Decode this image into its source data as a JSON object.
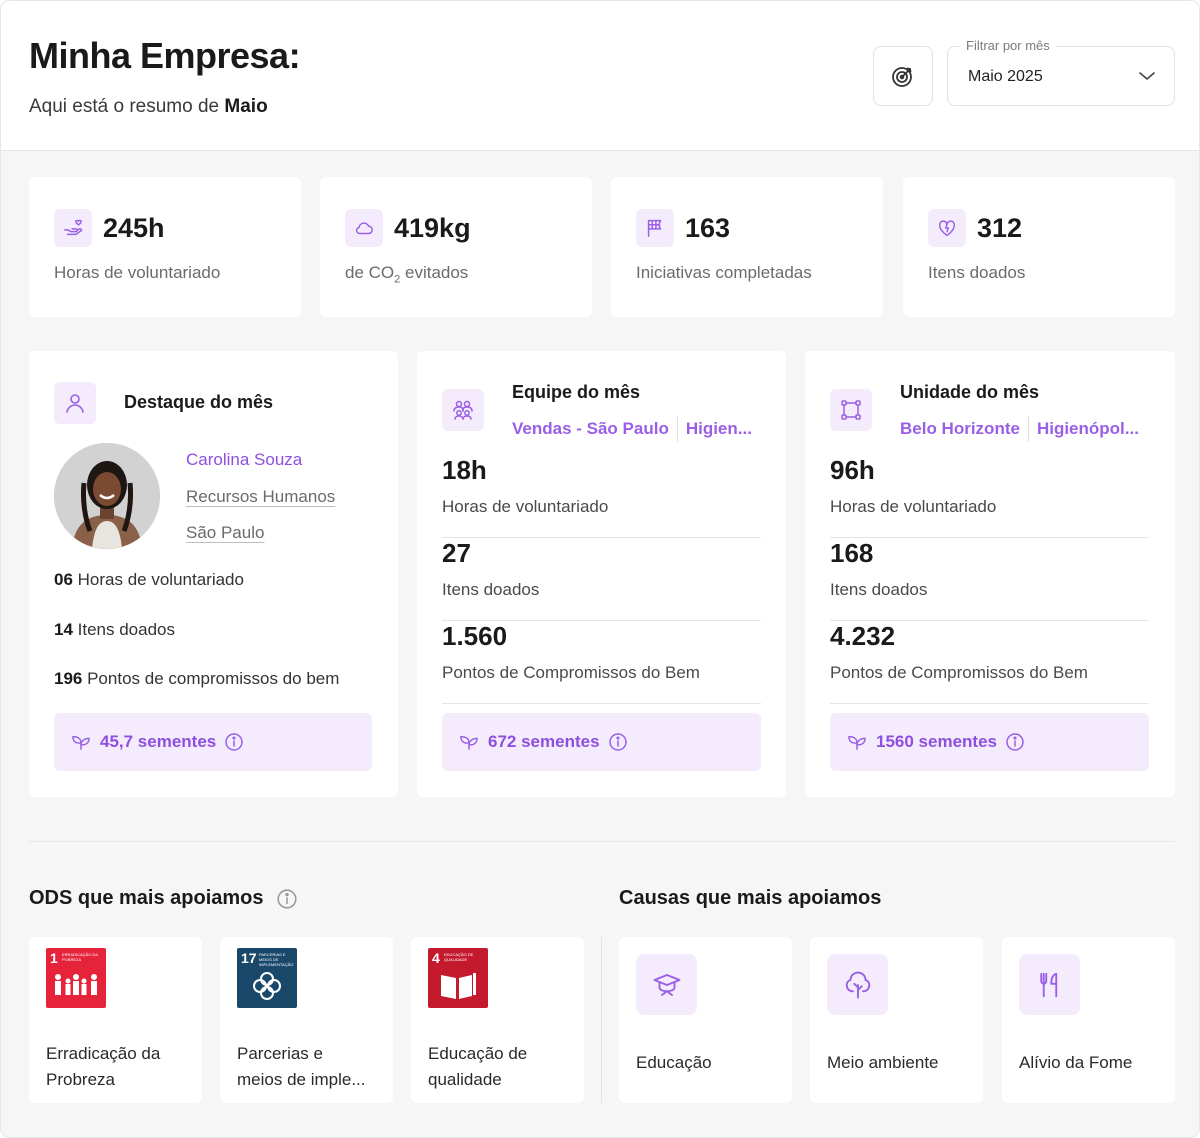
{
  "header": {
    "title": "Minha Empresa:",
    "subtitle_prefix": "Aqui está o resumo de ",
    "subtitle_month": "Maio",
    "filter_label": "Filtrar por mês",
    "filter_value": "Maio 2025",
    "goal_icon": "target-icon"
  },
  "kpis": [
    {
      "icon": "hands-heart-icon",
      "value": "245h",
      "label": "Horas de voluntariado"
    },
    {
      "icon": "cloud-icon",
      "value": "419kg",
      "label_prefix": "de CO",
      "label_sub": "2",
      "label_suffix": " evitados"
    },
    {
      "icon": "flag-icon",
      "value": "163",
      "label": "Iniciativas completadas"
    },
    {
      "icon": "heart-icon",
      "value": "312",
      "label": "Itens doados"
    }
  ],
  "highlight": {
    "title": "Destaque do mês",
    "name": "Carolina Souza",
    "department": "Recursos Humanos",
    "city": "São Paulo",
    "hours_value": "06",
    "hours_label": " Horas de voluntariado",
    "items_value": "14",
    "items_label": " Itens doados",
    "points_value": "196",
    "points_label": " Pontos de compromissos do bem",
    "seeds": "45,7 sementes"
  },
  "team": {
    "title": "Equipe do mês",
    "tags": [
      "Vendas - São Paulo",
      "Higien..."
    ],
    "metrics": [
      {
        "value": "18h",
        "label": "Horas de voluntariado"
      },
      {
        "value": "27",
        "label": "Itens doados"
      },
      {
        "value": "1.560",
        "label": "Pontos de Compromissos do Bem"
      }
    ],
    "seeds": "672 sementes"
  },
  "unit": {
    "title": "Unidade do mês",
    "tags": [
      "Belo Horizonte",
      "Higienópol..."
    ],
    "metrics": [
      {
        "value": "96h",
        "label": "Horas de voluntariado"
      },
      {
        "value": "168",
        "label": "Itens doados"
      },
      {
        "value": "4.232",
        "label": "Pontos de Compromissos do Bem"
      }
    ],
    "seeds": "1560 sementes"
  },
  "ods": {
    "title": "ODS que mais apoiamos",
    "items": [
      {
        "num": "1",
        "caption": "ERRADICAÇÃO DA POBREZA",
        "color": "#e5243b",
        "label_line1": "Erradicação da",
        "label_line2": "Probreza"
      },
      {
        "num": "17",
        "caption": "PARCERIAS E MEIOS DE IMPLEMENTAÇÃO",
        "color": "#19486a",
        "label_line1": "Parcerias e",
        "label_line2": "meios de imple..."
      },
      {
        "num": "4",
        "caption": "EDUCAÇÃO DE QUALIDADE",
        "color": "#c5192d",
        "label_line1": "Educação de",
        "label_line2": "qualidade"
      }
    ]
  },
  "causes": {
    "title": "Causas que mais apoiamos",
    "items": [
      {
        "icon": "graduation-icon",
        "label": "Educação"
      },
      {
        "icon": "tree-icon",
        "label": "Meio ambiente"
      },
      {
        "icon": "utensils-icon",
        "label": "Alívio da Fome"
      }
    ]
  },
  "colors": {
    "accent": "#8e4fe0",
    "accent_soft": "#f4ecfd"
  }
}
